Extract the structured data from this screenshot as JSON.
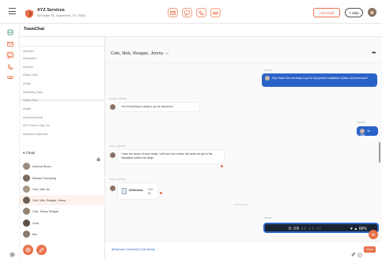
{
  "app": {
    "company_name": "XYZ Services",
    "company_address": "500 Main St, Grapevine, TX 76051",
    "add_staff_label": "Add Staff",
    "help_label": "Help",
    "section_title": "TeamChat"
  },
  "icons": {
    "menu": "hamburger-icon",
    "logo": "shield-logo",
    "center": [
      "mail-icon",
      "chat-icon",
      "phone-icon",
      "voicemail-icon"
    ],
    "nav": [
      "inbox-icon",
      "mail-icon",
      "chat-icon",
      "phone-icon",
      "voicemail-icon"
    ],
    "settings": "gear-icon"
  },
  "colors": {
    "accent": "#e8724c",
    "bubble_blue": "#2a63c7",
    "active_row": "#fdf3ec"
  },
  "channels": [
    "#Renders",
    "#Managers",
    "#Owners",
    "#Sales Team",
    "#Video",
    "#Marketing Team",
    "#Sales Team",
    "#Sales",
    "#UrnewsChannel",
    "#HP Premium Way Out",
    "#Updated Dashboard"
  ],
  "chats": {
    "label": "Chats",
    "items": [
      "Anthony Brown",
      "Michael Greenberg",
      "Cole, Nick, Az",
      "Cole, Nick, Reagan, Jimmy",
      "Cole, Jimmy, Reagan",
      "Cook",
      "Ben"
    ],
    "active_index": 3
  },
  "conversation": {
    "title": "Cole, Nick, Reagan, Jimmy",
    "extra_count": "+4",
    "more": "•••",
    "messages": [
      {
        "time": "2:40 PM",
        "text": "Hey Team!! Are we ready to go for Equipment Installation 2(Alice Lim) tomorrow?",
        "dir": "out"
      },
      {
        "sender": "Reagan, 3:05 PM",
        "text": "Yes! Everything is ready to go for tomorrow!",
        "dir": "in"
      },
      {
        "time": "3:35 PM",
        "text": "Ye Test",
        "dir": "out"
      },
      {
        "sender": "Jimmy, 3:51 PM",
        "text": "I have the scope of work ready. I will have him review this when we get to the installation before we begin.",
        "dir": "in"
      },
      {
        "sender": "Jimmy, 3:52 PM",
        "file_name": "SOW.docs",
        "file_size": "29.6 kB",
        "dir": "in"
      }
    ],
    "new_messages_label": "New Messages",
    "image_time": "3:53 PM",
    "image_text_left": "9:38 ↑↑ ↑↑ ↑↑",
    "image_text_right": "♥ ▲ 66%"
  },
  "composer": {
    "placeholder": "@Ravinder Conntell AZ (Cole Sasha)",
    "send_label": "Send"
  }
}
